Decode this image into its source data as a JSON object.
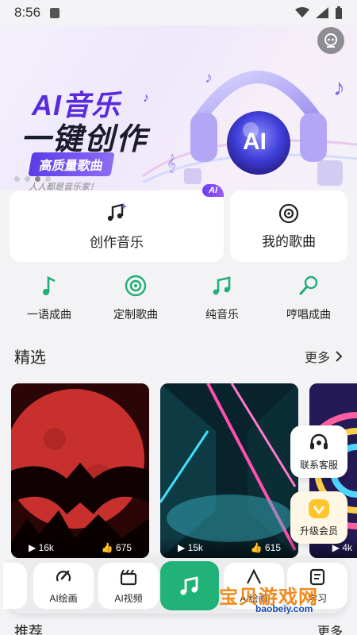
{
  "status_bar": {
    "time": "8:56"
  },
  "banner": {
    "title_line1": "AI音乐",
    "title_line2": "一键创作",
    "badge": "高质量歌曲",
    "slogan": "人人都是音乐家！",
    "ai_text": "AI",
    "active_dot": 2
  },
  "cards": {
    "create": {
      "label": "创作音乐",
      "tag": "AI"
    },
    "mine": {
      "label": "我的歌曲"
    }
  },
  "quick_actions": [
    {
      "label": "一语成曲",
      "icon": "music-note-icon"
    },
    {
      "label": "定制歌曲",
      "icon": "vinyl-disc-icon"
    },
    {
      "label": "纯音乐",
      "icon": "music-notes-icon"
    },
    {
      "label": "哼唱成曲",
      "icon": "microphone-icon"
    }
  ],
  "featured": {
    "title": "精选",
    "more": "更多",
    "items": [
      {
        "plays": "16k",
        "likes": "675"
      },
      {
        "plays": "15k",
        "likes": "615"
      },
      {
        "plays": "4k"
      }
    ]
  },
  "floating": {
    "service": "联系客服",
    "vip": "升级会员"
  },
  "dock": {
    "items": [
      {
        "label": "AI绘画",
        "icon": "paint-brush-icon"
      },
      {
        "label": "AI视频",
        "icon": "clapperboard-icon"
      },
      {
        "label": "",
        "icon": "music-note-icon"
      },
      {
        "label": "AI绘画",
        "icon": "paint-icon"
      },
      {
        "label": "学习",
        "icon": "book-icon"
      }
    ]
  },
  "watermark": {
    "main": "宝贝游戏网",
    "sub": "baobeiy.com"
  },
  "recommend": {
    "title": "推荐",
    "more": "更多"
  },
  "colors": {
    "accent_green": "#21b27a",
    "brand_purple": "#5a2bdc"
  }
}
